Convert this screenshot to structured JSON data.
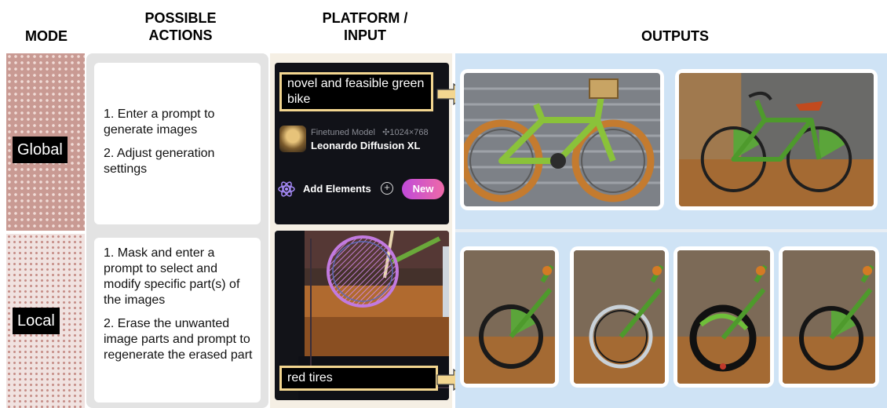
{
  "headers": {
    "mode": "MODE",
    "actions": "POSSIBLE\nACTIONS",
    "actions_line1": "POSSIBLE",
    "actions_line2": "ACTIONS",
    "platform_line1": "PLATFORM /",
    "platform_line2": "INPUT",
    "outputs": "OUTPUTS"
  },
  "rows": [
    {
      "mode": "Global",
      "actions": [
        "1. Enter a prompt to generate images",
        "2. Adjust generation settings"
      ],
      "prompt": "novel and feasible green bike",
      "ui": {
        "model_meta": "Finetuned Model",
        "resolution": "✣1024×768",
        "model_name": "Leonardo Diffusion XL",
        "add_elements": "Add Elements",
        "new_badge": "New"
      }
    },
    {
      "mode": "Local",
      "actions": [
        "1. Mask and enter a prompt to select and modify specific part(s) of the images",
        "2. Erase the unwanted image parts and prompt to regenerate the erased part"
      ],
      "prompt": "red tires"
    }
  ],
  "colors": {
    "global_mode": "#c99a93",
    "local_mode": "#f0e2e0",
    "prompt_border": "#f3d690",
    "outputs_bg": "#cfe3f5"
  }
}
